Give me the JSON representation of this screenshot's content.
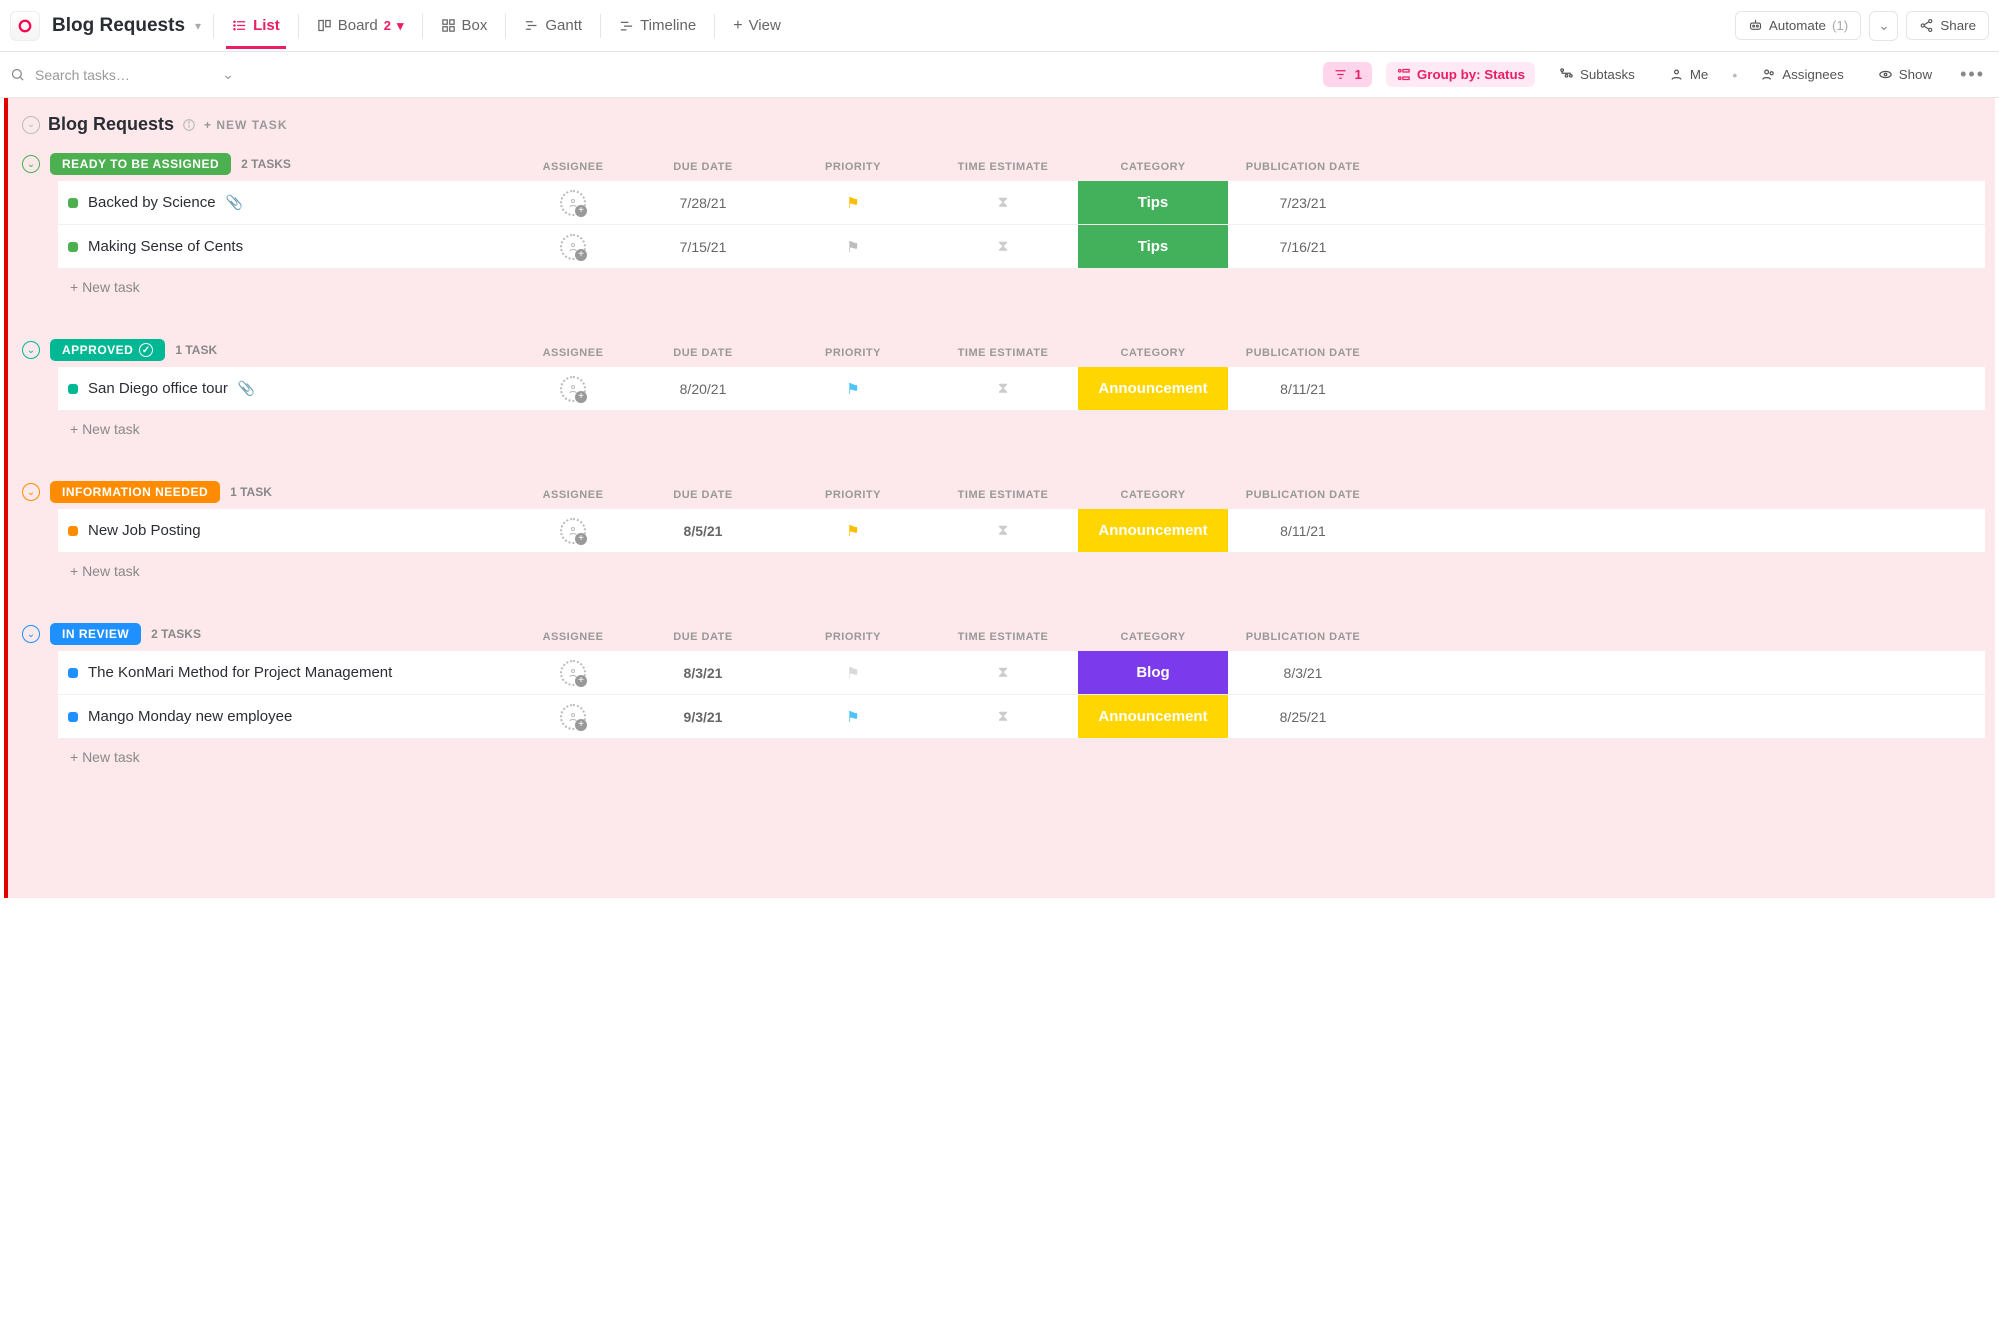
{
  "header": {
    "title": "Blog Requests",
    "views": {
      "list": {
        "label": "List"
      },
      "board": {
        "label": "Board",
        "badge": "2"
      },
      "box": {
        "label": "Box"
      },
      "gantt": {
        "label": "Gantt"
      },
      "timeline": {
        "label": "Timeline"
      },
      "addview": {
        "label": "View"
      }
    },
    "automate": {
      "label": "Automate",
      "count": "(1)"
    },
    "share": {
      "label": "Share"
    }
  },
  "toolbar": {
    "search_placeholder": "Search tasks…",
    "filter_count": "1",
    "groupby": "Group by: Status",
    "subtasks": "Subtasks",
    "me": "Me",
    "assignees": "Assignees",
    "show": "Show"
  },
  "list": {
    "name": "Blog Requests",
    "new_task_upper": "+ NEW TASK",
    "columns": {
      "assignee": "ASSIGNEE",
      "due": "DUE DATE",
      "priority": "PRIORITY",
      "time": "TIME ESTIMATE",
      "category": "CATEGORY",
      "pub": "PUBLICATION DATE"
    },
    "new_task": "+ New task",
    "groups": [
      {
        "id": "ready",
        "label": "READY TO BE ASSIGNED",
        "color": "#4CAF50",
        "checkmark": false,
        "count": "2 TASKS",
        "collapse_color": "#4CAF50",
        "tasks": [
          {
            "dot": "#4CAF50",
            "name": "Backed by Science",
            "attach": true,
            "due": "7/28/21",
            "due_red": false,
            "flag": "#ffbf00",
            "category": {
              "label": "Tips",
              "bg": "#43b05c"
            },
            "pub": "7/23/21"
          },
          {
            "dot": "#4CAF50",
            "name": "Making Sense of Cents",
            "attach": false,
            "due": "7/15/21",
            "due_red": false,
            "flag": "#bdbdbd",
            "category": {
              "label": "Tips",
              "bg": "#43b05c"
            },
            "pub": "7/16/21"
          }
        ]
      },
      {
        "id": "approved",
        "label": "APPROVED",
        "color": "#00b894",
        "checkmark": true,
        "count": "1 TASK",
        "collapse_color": "#00b894",
        "tasks": [
          {
            "dot": "#00b894",
            "name": "San Diego office tour",
            "attach": true,
            "due": "8/20/21",
            "due_red": false,
            "flag": "#4fc3f7",
            "category": {
              "label": "Announcement",
              "bg": "#ffd600"
            },
            "pub": "8/11/21"
          }
        ]
      },
      {
        "id": "info",
        "label": "INFORMATION NEEDED",
        "color": "#ff8c00",
        "checkmark": false,
        "count": "1 TASK",
        "collapse_color": "#ff8c00",
        "tasks": [
          {
            "dot": "#ff8c00",
            "name": "New Job Posting",
            "attach": false,
            "due": "8/5/21",
            "due_red": true,
            "flag": "#ffbf00",
            "category": {
              "label": "Announcement",
              "bg": "#ffd600"
            },
            "pub": "8/11/21"
          }
        ]
      },
      {
        "id": "review",
        "label": "IN REVIEW",
        "color": "#1e90ff",
        "checkmark": false,
        "count": "2 TASKS",
        "collapse_color": "#1e90ff",
        "tasks": [
          {
            "dot": "#1e90ff",
            "name": "The KonMari Method for Project Management",
            "attach": false,
            "due": "8/3/21",
            "due_red": true,
            "flag": "#d9d9d9",
            "category": {
              "label": "Blog",
              "bg": "#7c3aed"
            },
            "pub": "8/3/21"
          },
          {
            "dot": "#1e90ff",
            "name": "Mango Monday new employee",
            "attach": false,
            "due": "9/3/21",
            "due_red": true,
            "flag": "#4fc3f7",
            "category": {
              "label": "Announcement",
              "bg": "#ffd600"
            },
            "pub": "8/25/21"
          }
        ]
      }
    ]
  }
}
